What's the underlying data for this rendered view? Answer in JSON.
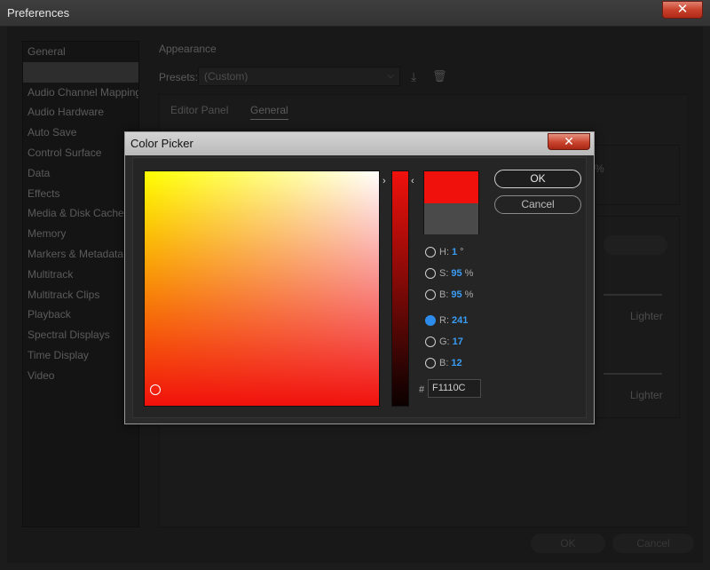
{
  "prefs": {
    "title": "Preferences",
    "close_label": "✕",
    "sidebar": [
      {
        "label": "General",
        "selected": false
      },
      {
        "label": "",
        "selected": true
      },
      {
        "label": "Audio Channel Mapping",
        "selected": false
      },
      {
        "label": "Audio Hardware",
        "selected": false
      },
      {
        "label": "Auto Save",
        "selected": false
      },
      {
        "label": "Control Surface",
        "selected": false
      },
      {
        "label": "Data",
        "selected": false
      },
      {
        "label": "Effects",
        "selected": false
      },
      {
        "label": "Media & Disk Cache",
        "selected": false
      },
      {
        "label": "Memory",
        "selected": false
      },
      {
        "label": "Markers & Metadata",
        "selected": false
      },
      {
        "label": "Multitrack",
        "selected": false
      },
      {
        "label": "Multitrack Clips",
        "selected": false
      },
      {
        "label": "Playback",
        "selected": false
      },
      {
        "label": "Spectral Displays",
        "selected": false
      },
      {
        "label": "Time Display",
        "selected": false
      },
      {
        "label": "Video",
        "selected": false
      }
    ],
    "section_title": "Appearance",
    "presets_label": "Presets:",
    "presets_value": "(Custom)",
    "tabs": [
      "Editor Panel",
      "General"
    ],
    "fragment_pct": "%",
    "lighter_1": "Lighter",
    "lighter_2": "Lighter",
    "ok_label": "OK",
    "cancel_label": "Cancel"
  },
  "color_picker": {
    "title": "Color Picker",
    "close_label": "✕",
    "ok_label": "OK",
    "cancel_label": "Cancel",
    "arrow_left": "›",
    "arrow_right": "‹",
    "new_color": "#f1110c",
    "old_color": "#4a4a4a",
    "fields": [
      {
        "label": "H:",
        "value": "1",
        "unit": "°",
        "selected": false
      },
      {
        "label": "S:",
        "value": "95",
        "unit": "%",
        "selected": false
      },
      {
        "label": "B:",
        "value": "95",
        "unit": "%",
        "selected": false
      },
      {
        "label": "R:",
        "value": "241",
        "unit": "",
        "selected": true
      },
      {
        "label": "G:",
        "value": "17",
        "unit": "",
        "selected": false
      },
      {
        "label": "B:",
        "value": "12",
        "unit": "",
        "selected": false
      }
    ],
    "hash_label": "#",
    "hex_value": "F1110C"
  }
}
